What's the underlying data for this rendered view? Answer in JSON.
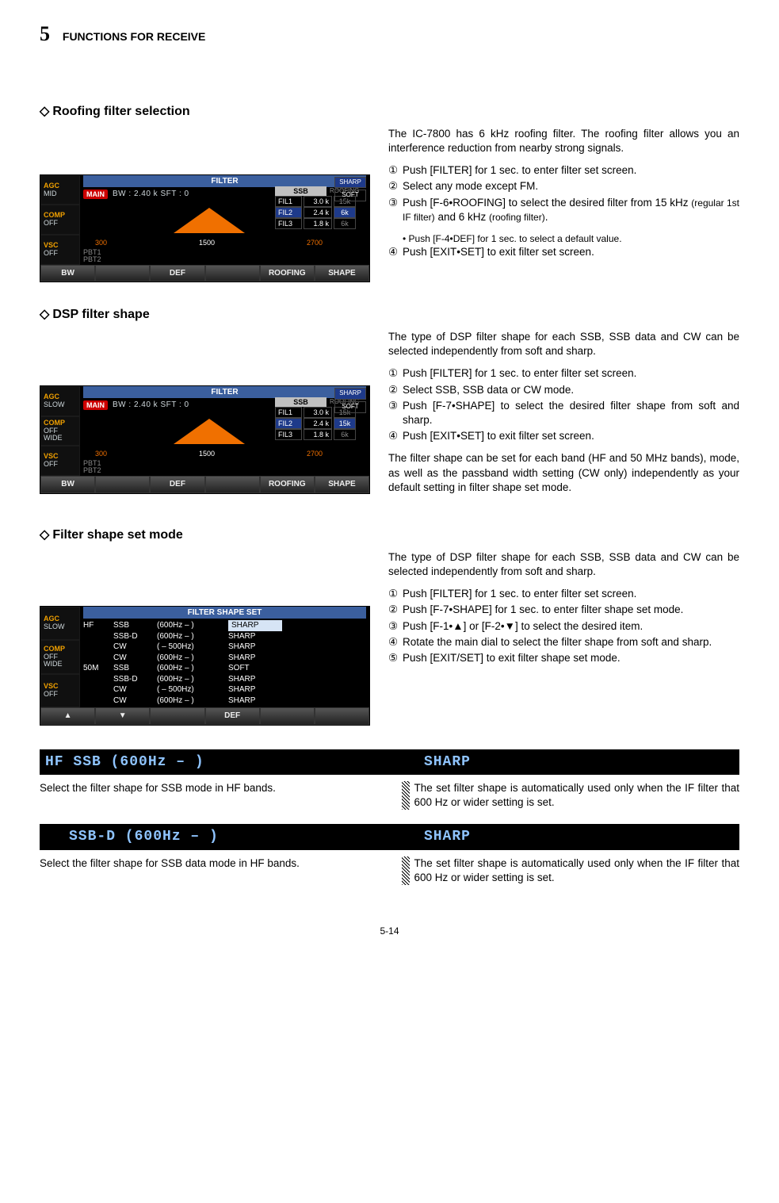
{
  "page": {
    "chapter_num": "5",
    "chapter_title": "FUNCTIONS FOR RECEIVE",
    "footer": "5-14"
  },
  "s1": {
    "title": "Roofing filter selection",
    "intro": "The IC-7800 has 6 kHz roofing filter. The roofing filter allows you an interference reduction from nearby strong signals.",
    "steps": {
      "1": "Push [FILTER] for 1 sec. to enter filter set screen.",
      "2": "Select any mode except FM.",
      "3a": "Push [F-6•ROOFING] to select the desired filter from 15 kHz",
      "3b": "(regular 1st IF filter)",
      "3c": "and 6 kHz",
      "3d": "(roofing filter)",
      "3e": ".",
      "3sub": "• Push [F-4•DEF] for 1 sec. to select a default value.",
      "4": "Push [EXIT•SET] to exit filter set screen."
    },
    "screen": {
      "title": "FILTER",
      "labels": {
        "agc": "AGC",
        "agc_v": "MID",
        "comp": "COMP",
        "comp_v": "OFF",
        "vsc": "VSC",
        "vsc_v": "OFF"
      },
      "main": "MAIN",
      "bw": "BW : 2.40 k   SFT :      0",
      "f_lo": "300",
      "f_mid": "1500",
      "f_hi": "2700",
      "pbt1": "PBT1",
      "pbt2": "PBT2",
      "ssb": "SSB",
      "roofing": "ROOFING",
      "fil1": "FIL1",
      "fil1v": "3.0 k",
      "r1": "15k",
      "fil2": "FIL2",
      "fil2v": "2.4 k",
      "r2": "6k",
      "fil3": "FIL3",
      "fil3v": "1.8 k",
      "r3": "6k",
      "sharp": "SHARP",
      "soft": "SOFT",
      "sk1": "BW",
      "sk2": "",
      "sk3": "DEF",
      "sk4": "",
      "sk5": "ROOFING",
      "sk6": "SHAPE"
    }
  },
  "s2": {
    "title": "DSP filter shape",
    "intro": "The type of DSP filter shape for each SSB, SSB data and CW can be selected independently from soft and sharp.",
    "steps": {
      "1": "Push [FILTER] for 1 sec. to enter filter set screen.",
      "2": "Select SSB, SSB data or CW mode.",
      "3": "Push [F-7•SHAPE] to select the desired filter shape from soft and sharp.",
      "4": "Push [EXIT•SET] to exit filter set screen."
    },
    "outro": "The filter shape can be set for each band (HF and 50 MHz bands), mode, as well as the passband width setting (CW only) independently as your default setting in filter shape set mode.",
    "screen": {
      "labels": {
        "agc": "AGC",
        "agc_v": "SLOW",
        "comp": "COMP",
        "comp_v1": "OFF",
        "comp_v2": "WIDE",
        "vsc": "VSC",
        "vsc_v": "OFF"
      },
      "r2": "15k"
    }
  },
  "s3": {
    "title": "Filter shape set mode",
    "intro": "The type of DSP filter shape for each SSB, SSB data and CW can be selected independently from soft and sharp.",
    "steps": {
      "1": "Push [FILTER] for 1 sec. to enter filter set screen.",
      "2": "Push [F-7•SHAPE] for 1 sec. to enter filter shape set mode.",
      "3": "Push [F-1•▲] or [F-2•▼] to select the desired item.",
      "4": "Rotate the main dial to select the filter shape from soft and sharp.",
      "5": "Push [EXIT/SET] to exit filter shape set mode."
    },
    "screen": {
      "title": "FILTER  SHAPE  SET",
      "labels": {
        "agc": "AGC",
        "agc_v": "SLOW",
        "comp": "COMP",
        "comp_v1": "OFF",
        "comp_v2": "WIDE",
        "vsc": "VSC",
        "vsc_v": "OFF"
      },
      "rows": [
        {
          "b": "HF",
          "m": "SSB",
          "w": "(600Hz – )",
          "s": "SHARP",
          "hl": true
        },
        {
          "b": "",
          "m": "SSB-D",
          "w": "(600Hz – )",
          "s": "SHARP"
        },
        {
          "b": "",
          "m": "CW",
          "w": "( – 500Hz)",
          "s": "SHARP"
        },
        {
          "b": "",
          "m": "CW",
          "w": "(600Hz – )",
          "s": "SHARP"
        },
        {
          "b": "50M",
          "m": "SSB",
          "w": "(600Hz – )",
          "s": "SOFT"
        },
        {
          "b": "",
          "m": "SSB-D",
          "w": "(600Hz – )",
          "s": "SHARP"
        },
        {
          "b": "",
          "m": "CW",
          "w": "( – 500Hz)",
          "s": "SHARP"
        },
        {
          "b": "",
          "m": "CW",
          "w": "(600Hz – )",
          "s": "SHARP"
        }
      ],
      "sk1": "▲",
      "sk2": "▼",
      "sk3": "",
      "sk4": "DEF",
      "sk5": "",
      "sk6": ""
    }
  },
  "info1": {
    "strip_left": "HF   SSB    (600Hz – )",
    "strip_right": "SHARP",
    "left_desc": "Select the filter shape for SSB mode in HF bands.",
    "right_desc": "The set filter shape is automatically used only when the IF filter that 600 Hz or wider setting is set."
  },
  "info2": {
    "strip_left": "SSB-D  (600Hz – )",
    "strip_right": "SHARP",
    "left_desc": "Select the filter shape for SSB data mode in HF bands.",
    "right_desc": "The set filter shape is automatically used only when the IF filter that 600 Hz or wider setting is set."
  },
  "circled": {
    "1": "①",
    "2": "②",
    "3": "③",
    "4": "④",
    "5": "⑤"
  }
}
